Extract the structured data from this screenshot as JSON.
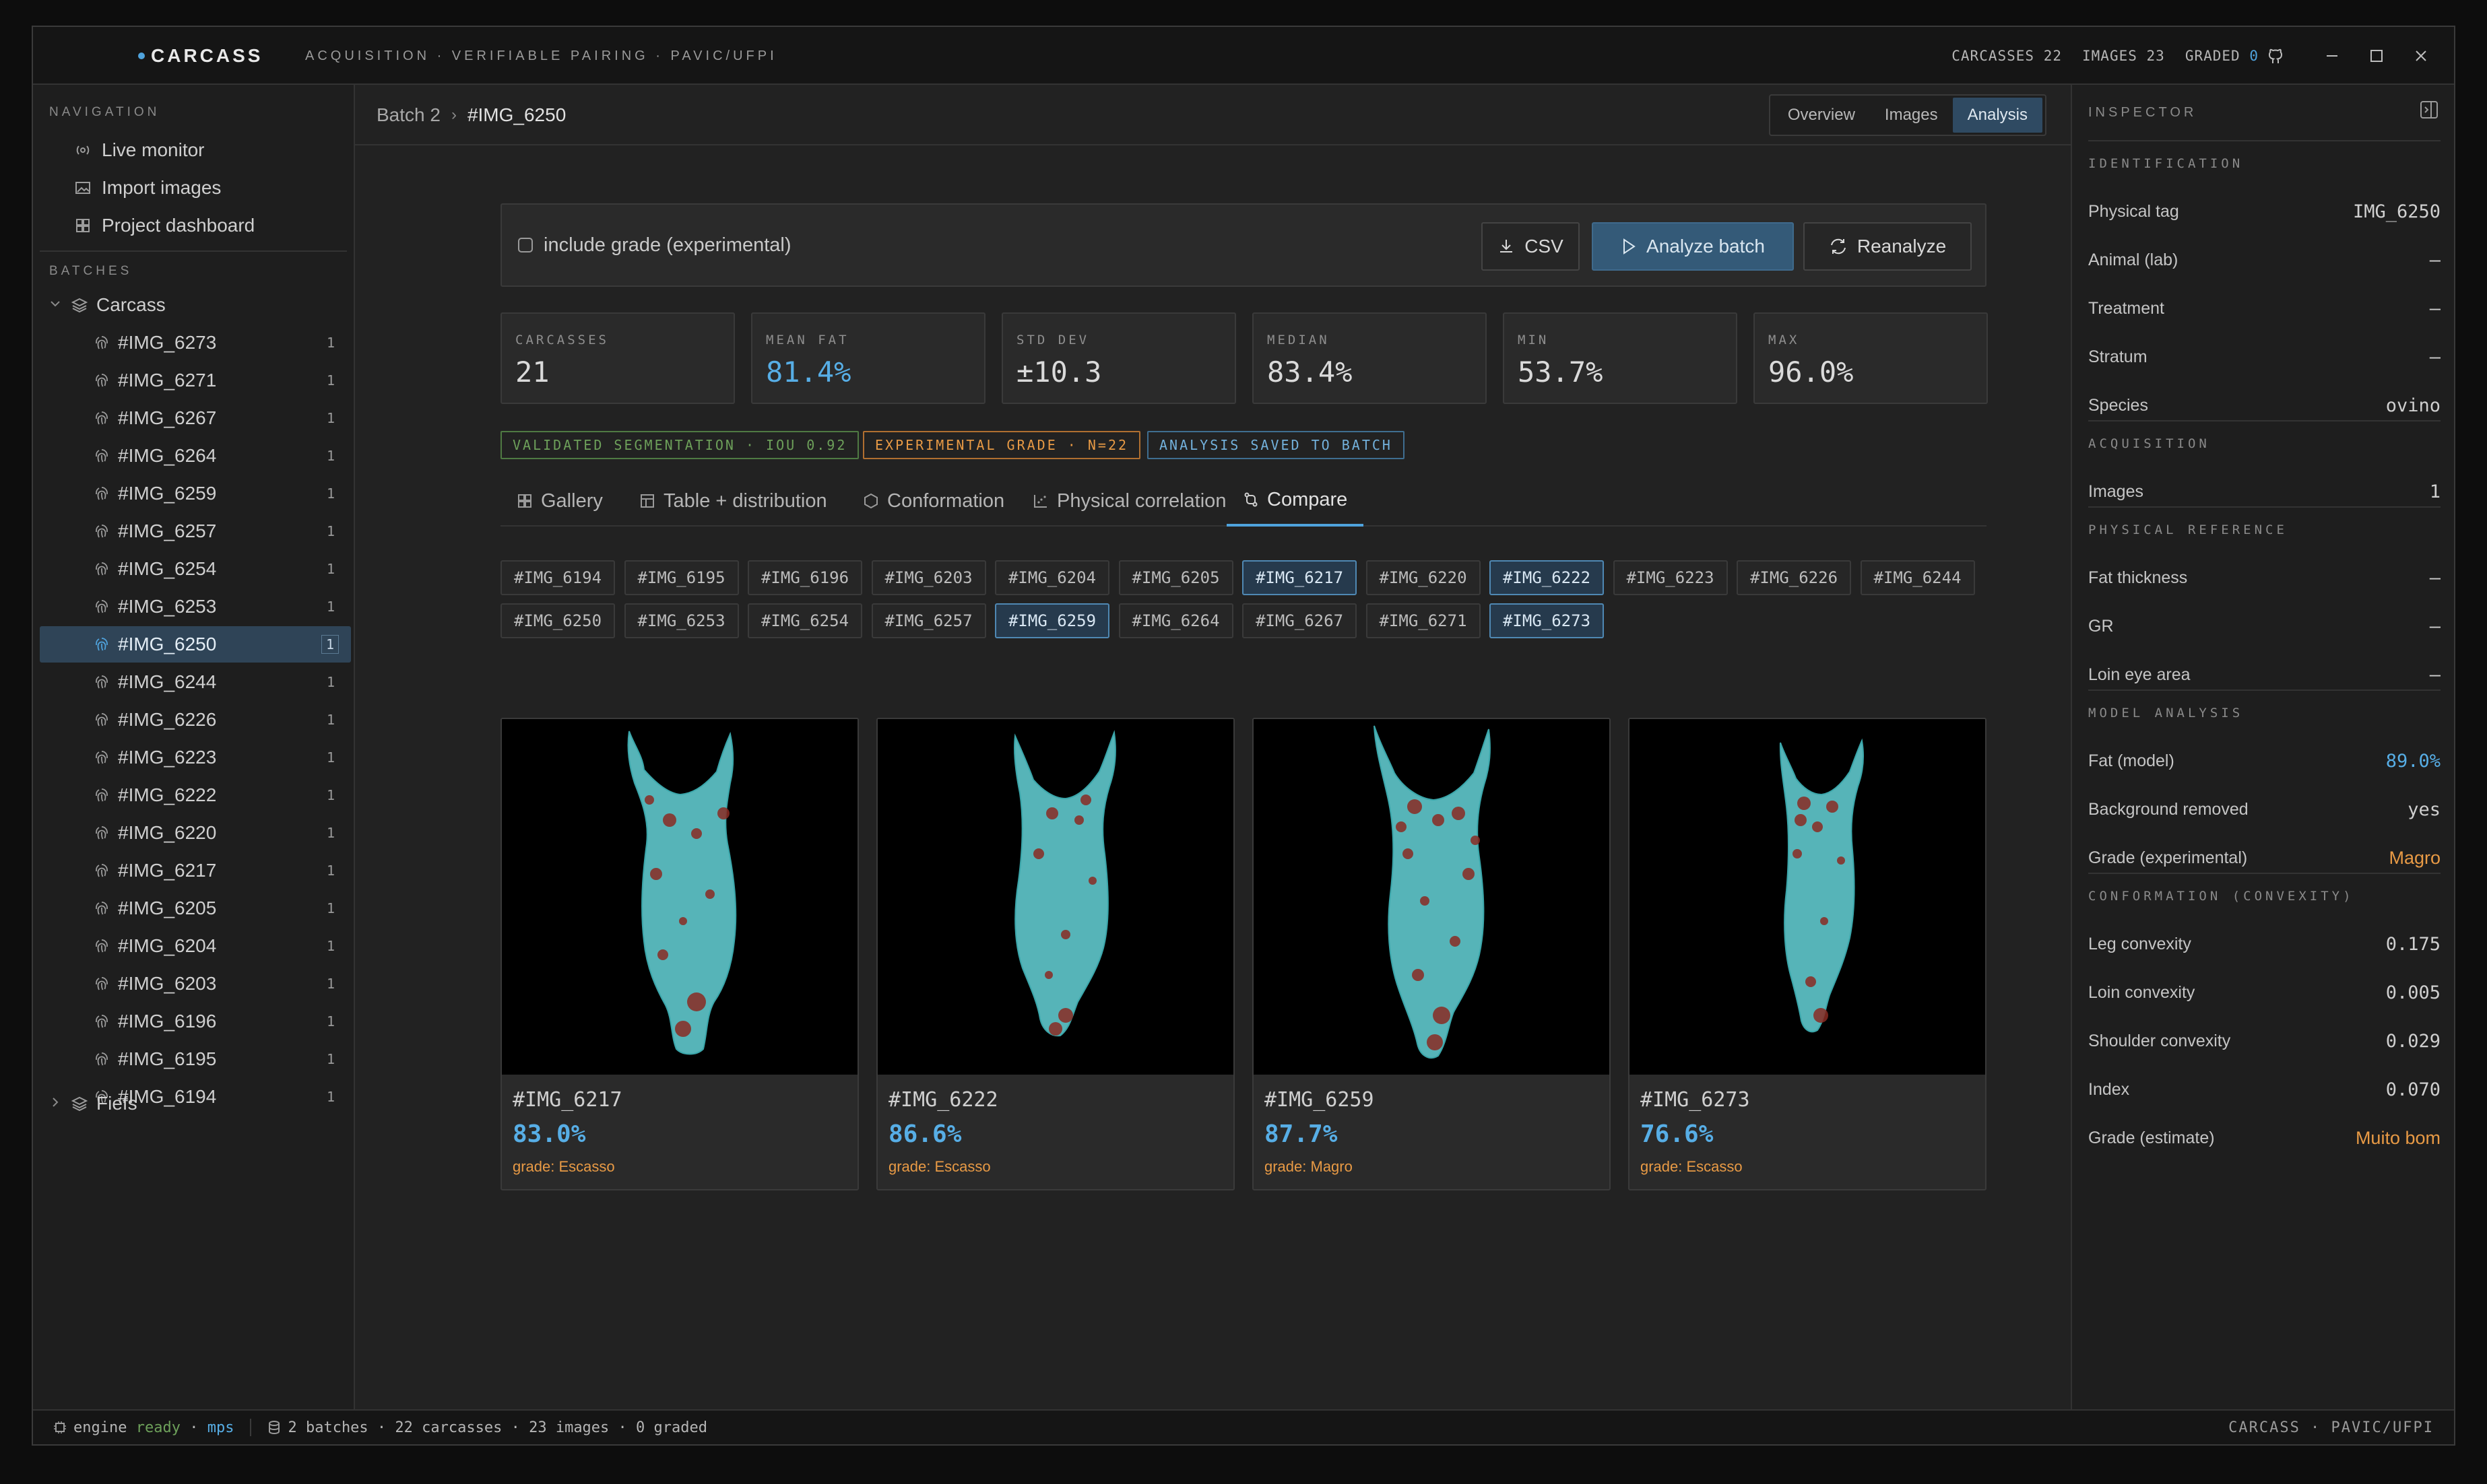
{
  "app": {
    "brand": "CARCASS",
    "subtitle": "ACQUISITION · VERIFIABLE PAIRING · PAVIC/UFPI",
    "counts": {
      "carcasses_label": "CARCASSES",
      "carcasses": "22",
      "images_label": "IMAGES",
      "images": "23",
      "graded_label": "GRADED",
      "graded": "0"
    }
  },
  "sidebar": {
    "nav_label": "NAVIGATION",
    "nav_items": [
      {
        "label": "Live monitor",
        "icon": "broadcast-icon"
      },
      {
        "label": "Import images",
        "icon": "image-icon"
      },
      {
        "label": "Project dashboard",
        "icon": "grid-icon"
      }
    ],
    "batches_label": "BATCHES",
    "tree_root": "Carcass",
    "tree_items": [
      {
        "label": "#IMG_6273",
        "count": "1"
      },
      {
        "label": "#IMG_6271",
        "count": "1"
      },
      {
        "label": "#IMG_6267",
        "count": "1"
      },
      {
        "label": "#IMG_6264",
        "count": "1"
      },
      {
        "label": "#IMG_6259",
        "count": "1"
      },
      {
        "label": "#IMG_6257",
        "count": "1"
      },
      {
        "label": "#IMG_6254",
        "count": "1"
      },
      {
        "label": "#IMG_6253",
        "count": "1"
      },
      {
        "label": "#IMG_6250",
        "count": "1"
      },
      {
        "label": "#IMG_6244",
        "count": "1"
      },
      {
        "label": "#IMG_6226",
        "count": "1"
      },
      {
        "label": "#IMG_6223",
        "count": "1"
      },
      {
        "label": "#IMG_6222",
        "count": "1"
      },
      {
        "label": "#IMG_6220",
        "count": "1"
      },
      {
        "label": "#IMG_6217",
        "count": "1"
      },
      {
        "label": "#IMG_6205",
        "count": "1"
      },
      {
        "label": "#IMG_6204",
        "count": "1"
      },
      {
        "label": "#IMG_6203",
        "count": "1"
      },
      {
        "label": "#IMG_6196",
        "count": "1"
      },
      {
        "label": "#IMG_6195",
        "count": "1"
      },
      {
        "label": "#IMG_6194",
        "count": "1"
      }
    ],
    "selected_item": "#IMG_6250",
    "tree_root2": "Fiefs"
  },
  "breadcrumb": {
    "batch": "Batch 2",
    "current": "#IMG_6250"
  },
  "view_tabs": [
    "Overview",
    "Images",
    "Analysis"
  ],
  "view_tab_active": "Analysis",
  "actions": {
    "include_grade": "include grade (experimental)",
    "csv": "CSV",
    "analyze": "Analyze batch",
    "reanalyze": "Reanalyze"
  },
  "metrics": [
    {
      "label": "CARCASSES",
      "value": "21"
    },
    {
      "label": "MEAN FAT",
      "value": "81.4%"
    },
    {
      "label": "STD DEV",
      "value": "±10.3"
    },
    {
      "label": "MEDIAN",
      "value": "83.4%"
    },
    {
      "label": "MIN",
      "value": "53.7%"
    },
    {
      "label": "MAX",
      "value": "96.0%"
    }
  ],
  "badges": {
    "segmentation": "VALIDATED SEGMENTATION · IOU 0.92",
    "grade": "EXPERIMENTAL GRADE · N=22",
    "saved": "ANALYSIS SAVED TO BATCH"
  },
  "tabs": [
    {
      "label": "Gallery",
      "icon": "gallery-icon"
    },
    {
      "label": "Table + distribution",
      "icon": "table-icon"
    },
    {
      "label": "Conformation",
      "icon": "hexagon-icon"
    },
    {
      "label": "Physical correlation",
      "icon": "scatter-icon"
    },
    {
      "label": "Compare",
      "icon": "compare-icon"
    }
  ],
  "active_tab": "Compare",
  "chips_row1": [
    "#IMG_6194",
    "#IMG_6195",
    "#IMG_6196",
    "#IMG_6203",
    "#IMG_6204",
    "#IMG_6205",
    "#IMG_6217",
    "#IMG_6220",
    "#IMG_6222",
    "#IMG_6223",
    "#IMG_6226",
    "#IMG_6244"
  ],
  "chips_row2": [
    "#IMG_6250",
    "#IMG_6253",
    "#IMG_6254",
    "#IMG_6257",
    "#IMG_6259",
    "#IMG_6264",
    "#IMG_6267",
    "#IMG_6271",
    "#IMG_6273"
  ],
  "selected_chips": [
    "#IMG_6217",
    "#IMG_6222",
    "#IMG_6259",
    "#IMG_6273"
  ],
  "compare_cards": [
    {
      "id": "#IMG_6217",
      "fat": "83.0%",
      "grade": "grade: Escasso"
    },
    {
      "id": "#IMG_6222",
      "fat": "86.6%",
      "grade": "grade: Escasso"
    },
    {
      "id": "#IMG_6259",
      "fat": "87.7%",
      "grade": "grade: Magro"
    },
    {
      "id": "#IMG_6273",
      "fat": "76.6%",
      "grade": "grade: Escasso"
    }
  ],
  "inspector": {
    "title": "INSPECTOR",
    "sections": [
      {
        "title": "IDENTIFICATION",
        "rows": [
          {
            "k": "Physical tag",
            "v": "IMG_6250"
          },
          {
            "k": "Animal (lab)",
            "v": "—"
          },
          {
            "k": "Treatment",
            "v": "—"
          },
          {
            "k": "Stratum",
            "v": "—"
          },
          {
            "k": "Species",
            "v": "ovino"
          }
        ]
      },
      {
        "title": "ACQUISITION",
        "rows": [
          {
            "k": "Images",
            "v": "1"
          }
        ]
      },
      {
        "title": "PHYSICAL REFERENCE",
        "rows": [
          {
            "k": "Fat thickness",
            "v": "—"
          },
          {
            "k": "GR",
            "v": "—"
          },
          {
            "k": "Loin eye area",
            "v": "—"
          }
        ]
      },
      {
        "title": "MODEL ANALYSIS",
        "rows": [
          {
            "k": "Fat (model)",
            "v": "89.0%",
            "style": "blue"
          },
          {
            "k": "Background removed",
            "v": "yes"
          },
          {
            "k": "Grade (experimental)",
            "v": "Magro",
            "style": "orange"
          }
        ]
      },
      {
        "title": "CONFORMATION (CONVEXITY)",
        "rows": [
          {
            "k": "Leg convexity",
            "v": "0.175"
          },
          {
            "k": "Loin convexity",
            "v": "0.005"
          },
          {
            "k": "Shoulder convexity",
            "v": "0.029"
          },
          {
            "k": "Index",
            "v": "0.070"
          },
          {
            "k": "Grade (estimate)",
            "v": "Muito bom",
            "style": "orange"
          }
        ]
      }
    ]
  },
  "status": {
    "engine": "engine",
    "ready": "ready",
    "dot": "·",
    "device": "mps",
    "summary": "2 batches · 22 carcasses · 23 images · 0 graded",
    "right": "CARCASS · PAVIC/UFPI"
  },
  "colors": {
    "accent": "#4fa3dd",
    "selected_bg": "#2f4457",
    "warn": "#e89a45",
    "ok": "#6da05a",
    "carcass": "#5fc8cc",
    "blood": "#8a2a22"
  }
}
